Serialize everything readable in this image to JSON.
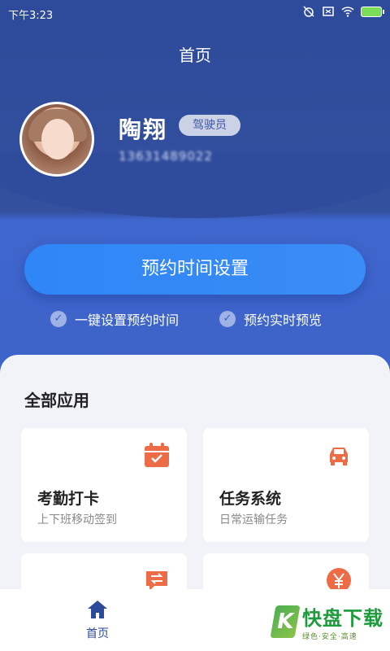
{
  "status_bar": {
    "time": "下午3:23"
  },
  "header": {
    "title": "首页"
  },
  "profile": {
    "name": "陶翔",
    "role": "驾驶员",
    "phone": "13631489022"
  },
  "cta": {
    "label": "预约时间设置"
  },
  "features": [
    {
      "label": "一键设置预约时间"
    },
    {
      "label": "预约实时预览"
    }
  ],
  "apps": {
    "title": "全部应用",
    "cards": [
      {
        "title": "考勤打卡",
        "subtitle": "上下班移动签到",
        "icon": "calendar-check-icon"
      },
      {
        "title": "任务系统",
        "subtitle": "日常运输任务",
        "icon": "car-icon"
      },
      {
        "title": "",
        "subtitle": "",
        "icon": "exchange-chat-icon"
      },
      {
        "title": "",
        "subtitle": "",
        "icon": "yuan-icon"
      }
    ]
  },
  "tabbar": {
    "home_label": "首页"
  },
  "watermark": {
    "brand": "快盘下载",
    "slogan": "绿色·安全·高速"
  },
  "colors": {
    "primary": "#2e4a9a",
    "button": "#3a8cf6",
    "icon_accent": "#ee6b47"
  }
}
